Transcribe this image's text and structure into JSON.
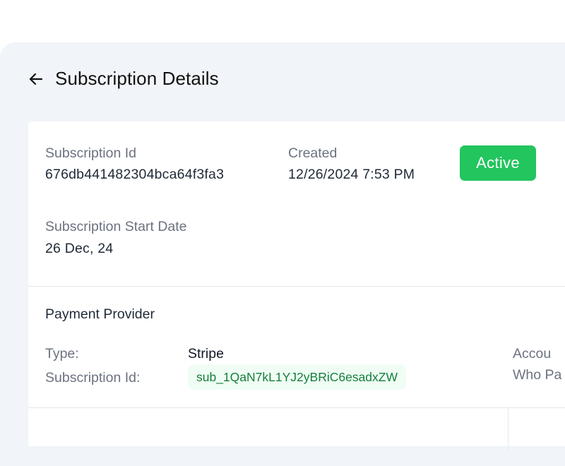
{
  "header": {
    "back_icon": "arrow-left-icon",
    "title": "Subscription Details"
  },
  "details": {
    "subscription_id_label": "Subscription Id",
    "subscription_id_value": "676db441482304bca64f3fa3",
    "created_label": "Created",
    "created_value": "12/26/2024 7:53 PM",
    "status": "Active",
    "start_date_label": "Subscription Start Date",
    "start_date_value": "26 Dec, 24"
  },
  "payment_provider": {
    "title": "Payment Provider",
    "type_label": "Type:",
    "type_value": "Stripe",
    "subscription_id_label": "Subscription Id:",
    "subscription_id_value": "sub_1QaN7kL1YJ2yBRiC6esadxZW",
    "account_label": "Accou",
    "who_pays_label": "Who Pa"
  },
  "colors": {
    "status_active": "#22c55e",
    "chip_bg": "#f0fdf4",
    "chip_text": "#15803d",
    "panel_bg": "#f1f5f9"
  }
}
